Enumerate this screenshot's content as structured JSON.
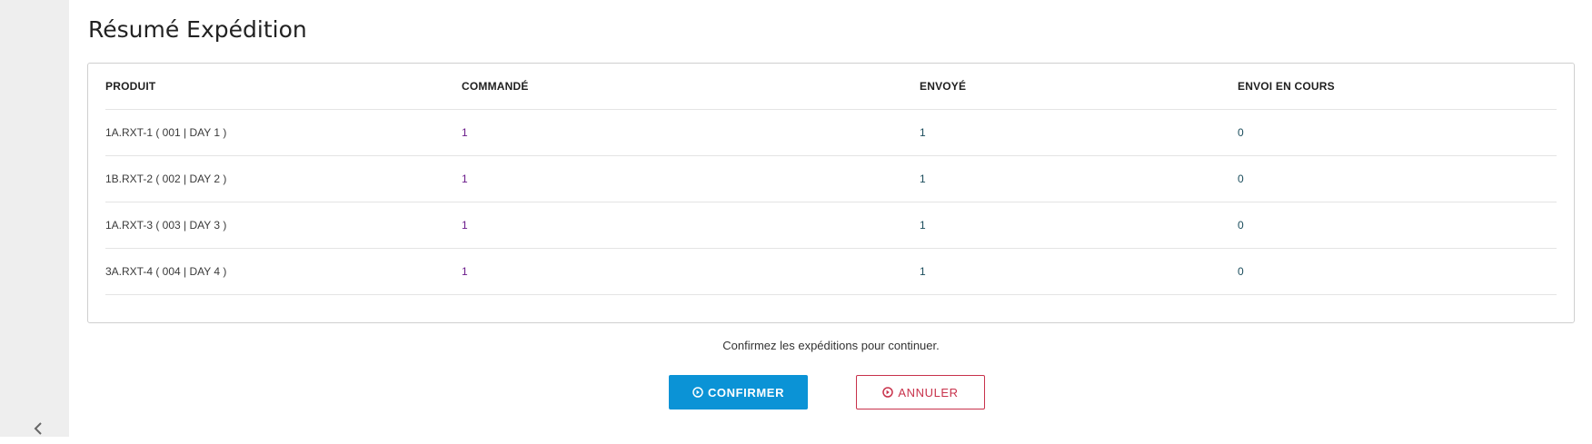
{
  "page": {
    "title": "Résumé Expédition"
  },
  "table": {
    "headers": {
      "product": "PRODUIT",
      "ordered": "COMMANDÉ",
      "sent": "ENVOYÉ",
      "in_progress": "ENVOI EN COURS"
    },
    "rows": [
      {
        "product": "1A.RXT-1 ( 001 | DAY 1 )",
        "ordered": "1",
        "sent": "1",
        "in_progress": "0"
      },
      {
        "product": "1B.RXT-2 ( 002 | DAY 2 )",
        "ordered": "1",
        "sent": "1",
        "in_progress": "0"
      },
      {
        "product": "1A.RXT-3 ( 003 | DAY 3 )",
        "ordered": "1",
        "sent": "1",
        "in_progress": "0"
      },
      {
        "product": "3A.RXT-4 ( 004 | DAY 4 )",
        "ordered": "1",
        "sent": "1",
        "in_progress": "0"
      }
    ]
  },
  "footer": {
    "hint": "Confirmez les expéditions pour continuer.",
    "confirm_label": "CONFIRMER",
    "cancel_label": "ANNULER",
    "confirm_icon": "arrow-circle-right-icon",
    "cancel_icon": "arrow-circle-right-icon"
  },
  "sidebar": {
    "collapse_icon": "chevron-left-icon"
  },
  "colors": {
    "primary": "#0b93d6",
    "danger": "#c8324b"
  }
}
